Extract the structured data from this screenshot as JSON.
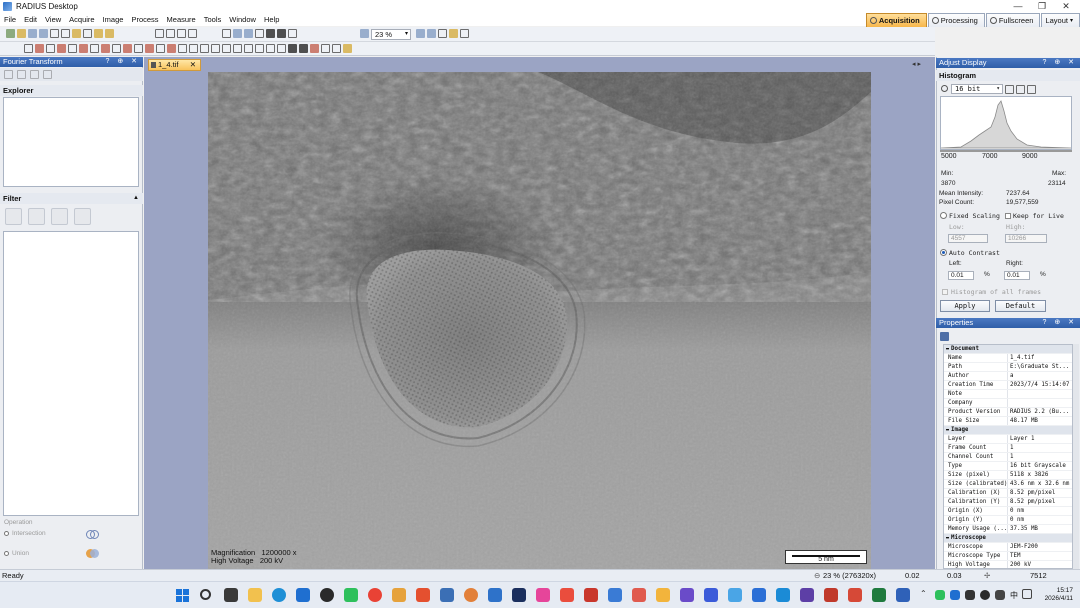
{
  "window": {
    "title": "RADIUS Desktop",
    "controls": [
      "—",
      "❐",
      "✕"
    ]
  },
  "menu": [
    "File",
    "Edit",
    "View",
    "Acquire",
    "Image",
    "Process",
    "Measure",
    "Tools",
    "Window",
    "Help"
  ],
  "mode_tabs": [
    {
      "label": "Acquisition",
      "active": true
    },
    {
      "label": "Processing",
      "active": false
    },
    {
      "label": "Fullscreen",
      "active": false
    },
    {
      "label": "Layout",
      "active": false
    }
  ],
  "toolbar": {
    "zoom_value": "23 %"
  },
  "left_panel": {
    "title": "Fourier Transform",
    "explorer_label": "Explorer",
    "filter_label": "Filter",
    "operation_label": "Operation",
    "intersection_label": "Intersection",
    "union_label": "Union"
  },
  "document": {
    "tab_label": "1_4.tif",
    "magnification_label": "Magnification",
    "magnification_value": "1200000 x",
    "high_voltage_label": "High Voltage",
    "high_voltage_value": "200 kV",
    "scale_bar_label": "5 nm"
  },
  "adjust_display": {
    "title": "Adjust Display",
    "histogram_label": "Histogram",
    "bit_depth": "16 bit",
    "axis_ticks": [
      "5000",
      "7000",
      "9000"
    ],
    "min_label": "Min:",
    "max_label": "Max:",
    "min_value": "3870",
    "max_value": "23114",
    "mean_label": "Mean Intensity:",
    "mean_value": "7237.64",
    "pixel_count_label": "Pixel Count:",
    "pixel_count_value": "19,577,559",
    "fixed_scaling_label": "Fixed Scaling",
    "keep_for_live_label": "Keep for Live",
    "low_label": "Low:",
    "low_value": "4557",
    "high_label": "High:",
    "high_value": "10266",
    "auto_contrast_label": "Auto Contrast",
    "left_label": "Left:",
    "left_value": "0.01",
    "right_label": "Right:",
    "right_value": "0.01",
    "percent": "%",
    "hist_all_frames_label": "Histogram of all frames",
    "apply_label": "Apply",
    "default_label": "Default"
  },
  "properties": {
    "title": "Properties",
    "rows": [
      {
        "cat": "Document"
      },
      {
        "k": "Name",
        "v": "1_4.tif"
      },
      {
        "k": "Path",
        "v": "E:\\Graduate St..."
      },
      {
        "k": "Author",
        "v": "a"
      },
      {
        "k": "Creation Time",
        "v": "2023/7/4 15:14:07"
      },
      {
        "k": "Note",
        "v": ""
      },
      {
        "k": "Company",
        "v": ""
      },
      {
        "k": "Product Version",
        "v": "RADIUS 2.2 (Bu..."
      },
      {
        "k": "File Size",
        "v": "48.17 MB"
      },
      {
        "cat": "Image"
      },
      {
        "k": "Layer",
        "v": "Layer 1"
      },
      {
        "k": "Frame Count",
        "v": "1"
      },
      {
        "k": "Channel Count",
        "v": "1"
      },
      {
        "k": "Type",
        "v": "16 bit Grayscale"
      },
      {
        "k": "Size (pixel)",
        "v": "5118 x 3826"
      },
      {
        "k": "Size (calibrated)",
        "v": "43.6 nm x 32.6 nm"
      },
      {
        "k": "Calibration (X)",
        "v": "8.52 pm/pixel"
      },
      {
        "k": "Calibration (Y)",
        "v": "8.52 pm/pixel"
      },
      {
        "k": "Origin (X)",
        "v": "0 nm"
      },
      {
        "k": "Origin (Y)",
        "v": "0 nm"
      },
      {
        "k": "Memory Usage (...",
        "v": "37.35 MB"
      },
      {
        "cat": "Microscope"
      },
      {
        "k": "Microscope",
        "v": "JEM-F200"
      },
      {
        "k": "Microscope Type",
        "v": "TEM"
      },
      {
        "k": "High Voltage",
        "v": "200 kV"
      }
    ]
  },
  "status": {
    "ready": "Ready",
    "zoom": "23 % (276320x)",
    "v1": "0.02",
    "v2": "0.03",
    "v3": "7512"
  },
  "taskbar": {
    "ime": "中",
    "time": "15:17",
    "date": "2026/4/11"
  },
  "colors": {
    "accent": "#2f5ea8",
    "doc_bg": "#9ba4c4",
    "active_tab": "#f7b64a"
  }
}
